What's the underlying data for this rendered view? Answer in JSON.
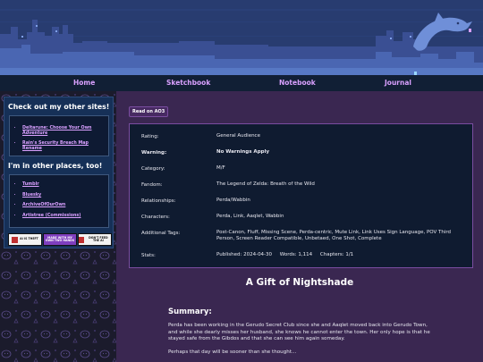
{
  "nav": {
    "items": [
      {
        "label": "Home"
      },
      {
        "label": "Sketchbook"
      },
      {
        "label": "Notebook"
      },
      {
        "label": "Journal"
      }
    ]
  },
  "sidebar": {
    "sites_title": "Check out my other sites!",
    "sites": [
      {
        "label": "Deltarune: Choose Your Own Adventure"
      },
      {
        "label": "Rain's Security Breach Map Rename"
      }
    ],
    "places_title": "I'm in other places, too!",
    "places": [
      {
        "label": "Tumblr"
      },
      {
        "label": "Bluesky"
      },
      {
        "label": "ArchiveOfOurOwn"
      },
      {
        "label": "Artistree (Commissions)"
      }
    ],
    "badges": [
      {
        "text": "AI IS THEFT",
        "color": "#f2f2f2"
      },
      {
        "text": "MADE WITH MY OWN TWO HANDS",
        "color": "#7f3fbf"
      },
      {
        "text": "DON'T FEED THE AI",
        "color": "#f2f2f2"
      }
    ]
  },
  "main": {
    "ao3_button": "Read on AO3",
    "meta": {
      "rating_label": "Rating:",
      "rating": "General Audience",
      "warning_label": "Warning:",
      "warning": "No Warnings Apply",
      "category_label": "Category:",
      "category": "M/F",
      "fandom_label": "Fandom:",
      "fandom": "The Legend of Zelda: Breath of the Wild",
      "relationships_label": "Relationships:",
      "relationships": "Perda/Wabbin",
      "characters_label": "Characters:",
      "characters": "Perda, Link, Aaqlet, Wabbin",
      "tags_label": "Additional Tags:",
      "tags": "Post-Canon, Fluff, Missing Scene, Perda-centric, Mute Link, Link Uses Sign Language, POV Third Person, Screen Reader Compatible, Unbetaed, One Shot, Complete",
      "stats_label": "Stats:",
      "stats": "Published: 2024-04-30     Words: 1,114     Chapters: 1/1"
    },
    "title": "A Gift of Nightshade",
    "summary_heading": "Summary:",
    "summary_p1": "Perda has been working in the Gerudo Secret Club since she and Aaqlet moved back into Gerudo Town, and while she dearly misses her husband, she knows he cannot enter the town. Her only hope is that he stayed safe from the Gibdos and that she can see him again someday.",
    "summary_p2": "Perhaps that day will be sooner than she thought..."
  },
  "colors": {
    "banner": "#26386b",
    "nav": "#111f35",
    "accent": "#d9a0ff",
    "main_bg": "#3a2751",
    "meta_bg": "#0f1b30",
    "sidebar_box": "#163057"
  }
}
